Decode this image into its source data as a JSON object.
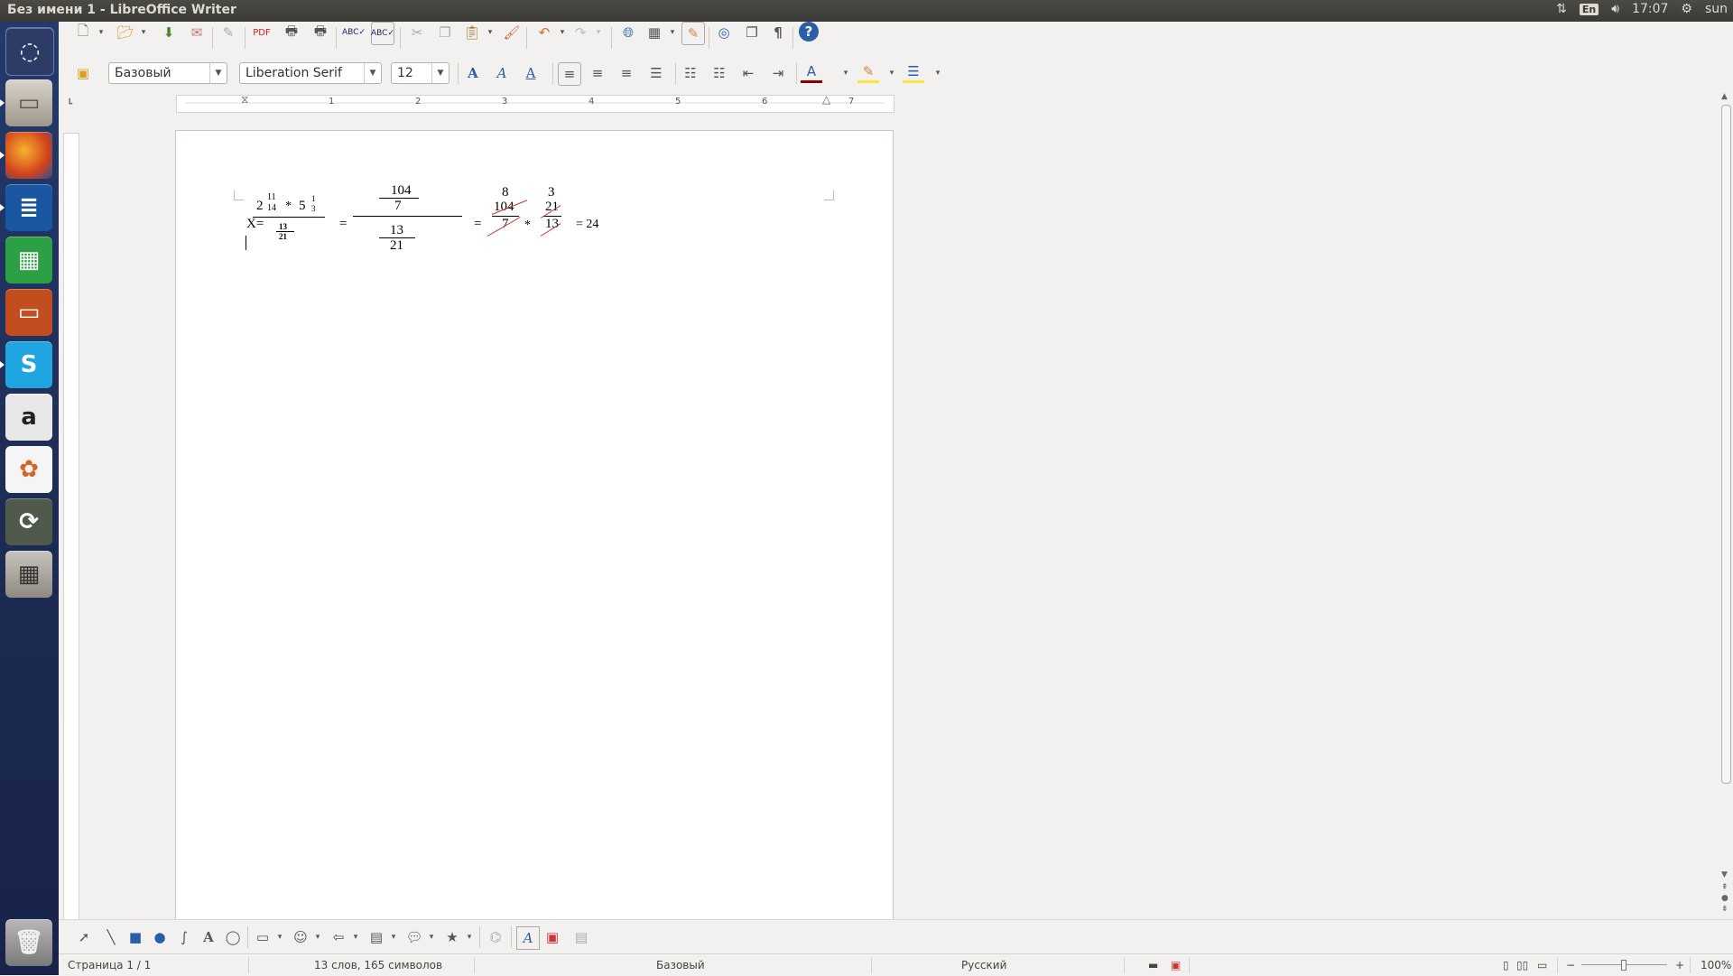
{
  "window": {
    "title": "Без имени 1 - LibreOffice Writer"
  },
  "panel": {
    "lang": "En",
    "time": "17:07",
    "user": "sun"
  },
  "launcher": [
    "dash-home",
    "files",
    "firefox",
    "writer",
    "calc",
    "impress",
    "skype",
    "amazon",
    "software-center",
    "updates",
    "calculator",
    "trash"
  ],
  "formatting": {
    "style": "Базовый",
    "font": "Liberation Serif",
    "size": "12"
  },
  "ruler": {
    "numbers": [
      "1",
      "2",
      "3",
      "4",
      "5",
      "6",
      "7"
    ]
  },
  "math": {
    "x_label": "X=",
    "eq": "=",
    "mult": "*",
    "mixed1_whole": "2",
    "mixed1_num": "11",
    "mixed1_den": "14",
    "mixed2_whole": "5",
    "mixed2_num": "1",
    "mixed2_den": "3",
    "den_num": "13",
    "den_den": "21",
    "step2_top_num": "104",
    "step2_top_den": "7",
    "step2_bot_num": "13",
    "step2_bot_den": "21",
    "cancel1_top": "8",
    "cancel1_num": "104",
    "cancel1_den": "7",
    "cancel2_top": "3",
    "cancel2_num": "21",
    "cancel2_den": "13",
    "result": "= 24"
  },
  "status": {
    "page": "Страница 1 / 1",
    "words": "13 слов, 165 символов",
    "style": "Базовый",
    "language": "Русский",
    "zoom": "100%"
  }
}
